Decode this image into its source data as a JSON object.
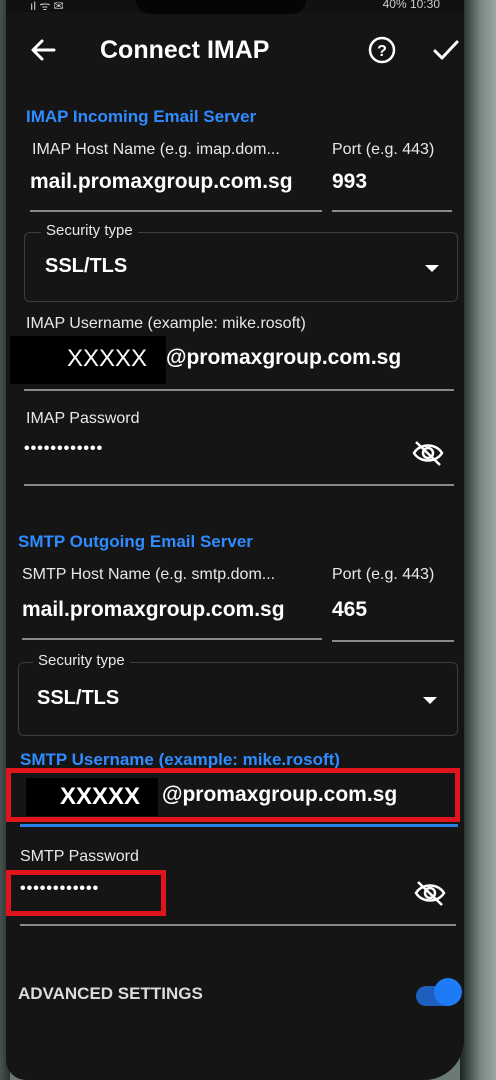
{
  "status": {
    "left": "ıl ᯤ ✉",
    "right": "40% 10:30"
  },
  "appbar": {
    "title": "Connect IMAP"
  },
  "imap": {
    "section_title": "IMAP Incoming Email Server",
    "host_label": "IMAP Host Name (e.g. imap.dom...",
    "host_value": "mail.promaxgroup.com.sg",
    "port_label": "Port (e.g. 443)",
    "port_value": "993",
    "security_label": "Security type",
    "security_value": "SSL/TLS",
    "username_label": "IMAP Username (example: mike.rosoft)",
    "username_redacted": "XXXXX",
    "username_suffix": "@promaxgroup.com.sg",
    "password_label": "IMAP Password",
    "password_value": "••••••••••••"
  },
  "smtp": {
    "section_title": "SMTP Outgoing Email Server",
    "host_label": "SMTP Host Name (e.g. smtp.dom...",
    "host_value": "mail.promaxgroup.com.sg",
    "port_label": "Port (e.g. 443)",
    "port_value": "465",
    "security_label": "Security type",
    "security_value": "SSL/TLS",
    "username_label": "SMTP Username (example: mike.rosoft)",
    "username_redacted": "XXXXX",
    "username_suffix": "@promaxgroup.com.sg",
    "password_label": "SMTP Password",
    "password_value": "••••••••••••"
  },
  "advanced": {
    "label": "ADVANCED SETTINGS",
    "enabled": true
  },
  "colors": {
    "accent": "#2f8cff",
    "highlight": "#e0141c",
    "background": "#151515"
  },
  "icons": {
    "back": "arrow-left-icon",
    "help": "help-circle-icon",
    "save": "check-icon",
    "visibility": "eye-off-icon",
    "dropdown": "caret-down-icon"
  }
}
